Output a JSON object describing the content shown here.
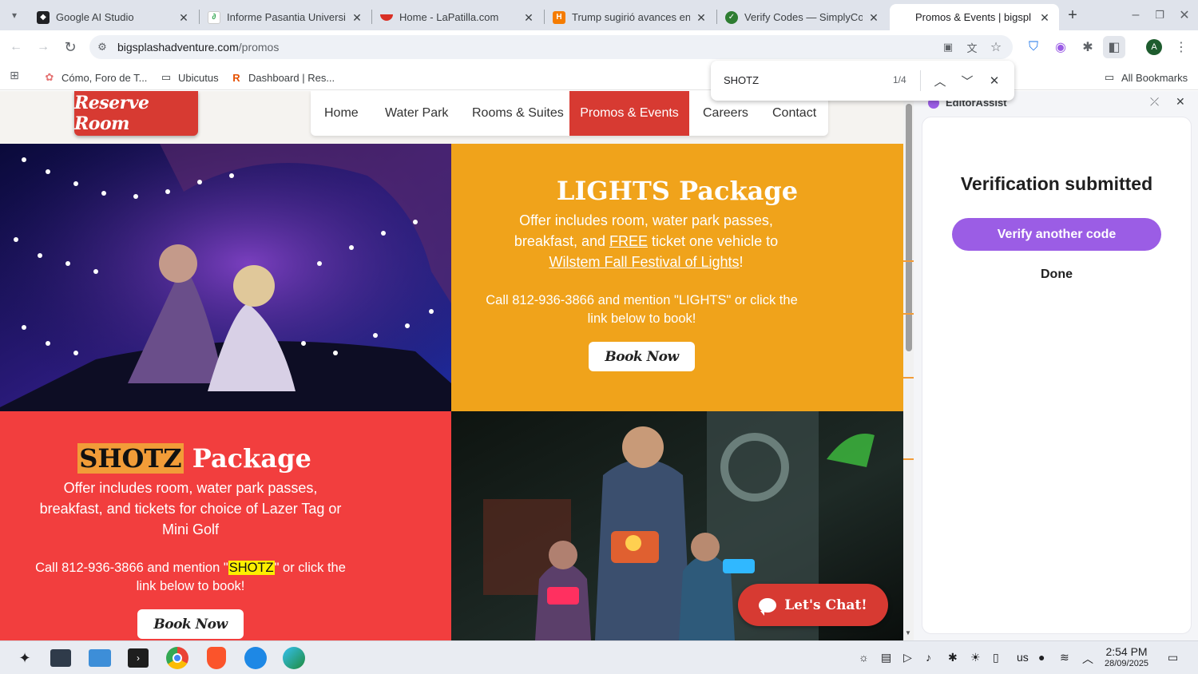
{
  "browser": {
    "tabs": [
      {
        "title": "Google AI Studio",
        "icon": "google-ai-studio-icon",
        "color": "#202124"
      },
      {
        "title": "Informe Pasantia Universi",
        "icon": "link-icon",
        "color": "#34a853"
      },
      {
        "title": "Home - LaPatilla.com",
        "icon": "watermelon-icon",
        "color": "#d93025"
      },
      {
        "title": "Trump sugirió avances en",
        "icon": "news-icon",
        "color": "#f57c00"
      },
      {
        "title": "Verify Codes — SimplyCod",
        "icon": "checkmark-icon",
        "color": "#2e7d32"
      },
      {
        "title": "Promos & Events | bigspl",
        "icon": "none",
        "color": "#ffffff"
      }
    ],
    "url_domain": "bigsplashadventure.com",
    "url_path": "/promos",
    "bookmarks": [
      {
        "label": "Cómo, Foro de T...",
        "icon": "flower-icon"
      },
      {
        "label": "Ubicutus",
        "icon": "folder-icon"
      },
      {
        "label": "Dashboard | Res...",
        "icon": "r-logo-icon"
      }
    ],
    "all_bookmarks": "All Bookmarks",
    "profile_initial": "A"
  },
  "findbar": {
    "query": "SHOTZ",
    "count": "1/4"
  },
  "site": {
    "logo_text": "Reserve Room",
    "nav": [
      "Home",
      "Water Park",
      "Rooms & Suites",
      "Promos & Events",
      "Careers",
      "Contact"
    ],
    "active_nav": "Promos & Events",
    "lights": {
      "title": "LIGHTS Package",
      "text_1": "Offer includes room, water park passes,",
      "text_2a": "breakfast, and ",
      "text_2b": "FREE",
      "text_2c": " ticket one vehicle to",
      "text_3a": "Wilstem Fall Festival of Lights",
      "text_3b": "!",
      "call_1": "Call 812-936-3866 and mention \"LIGHTS\" or click the",
      "call_2": "link below to book!",
      "button": "Book Now"
    },
    "shotz": {
      "title_highlight": "SHOTZ",
      "title_rest": " Package",
      "text_1": "Offer includes room, water park passes,",
      "text_2": "breakfast, and tickets for choice of Lazer Tag or",
      "text_3": "Mini Golf",
      "call_1a": "Call 812-936-3866 and mention \"",
      "call_1b": "SHOTZ",
      "call_1c": "\" or click the",
      "call_2": "link below to book!",
      "button": "Book Now"
    },
    "chat_label": "Let's Chat!",
    "colors": {
      "brand_red": "#d73a32",
      "lights_bg": "#f0a31b",
      "shotz_bg": "#f23e3e"
    }
  },
  "sidepanel": {
    "title": "EditorAssist",
    "status": "Verification submitted",
    "verify_button": "Verify another code",
    "done_button": "Done",
    "accent": "#9b5de5"
  },
  "taskbar": {
    "apps": [
      "launcher-icon",
      "terminal-icon",
      "files-icon",
      "console-icon",
      "chrome-icon",
      "brave-icon",
      "remote-icon",
      "edge-icon"
    ],
    "keyboard_layout": "us",
    "time": "2:54 PM",
    "date": "28/09/2025"
  }
}
